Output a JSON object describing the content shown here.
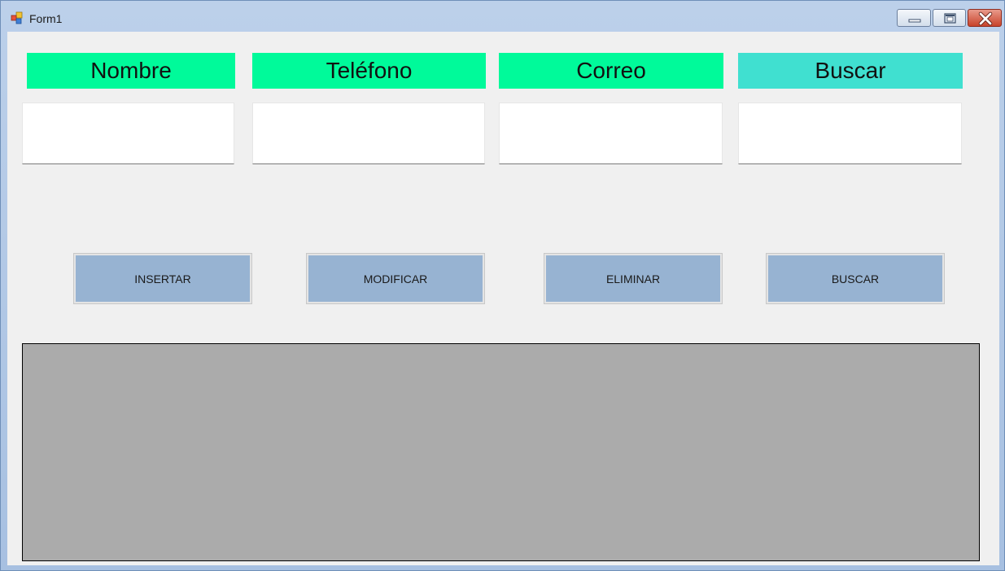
{
  "window": {
    "title": "Form1"
  },
  "title_buttons": {
    "minimize": "minimize-icon",
    "maximize": "maximize-icon",
    "close": "close-icon"
  },
  "labels": {
    "nombre": "Nombre",
    "telefono": "Teléfono",
    "correo": "Correo",
    "buscar": "Buscar"
  },
  "fields": {
    "nombre": "",
    "telefono": "",
    "correo": "",
    "buscar": ""
  },
  "buttons": {
    "insertar": "INSERTAR",
    "modificar": "MODIFICAR",
    "eliminar": "ELIMINAR",
    "buscar": "BUSCAR"
  },
  "colors": {
    "label_green": "#00fa9a",
    "label_cyan": "#40e0d0",
    "button": "#97b3d2",
    "grid_background": "#ababab",
    "form_background": "#f0f0f0"
  }
}
